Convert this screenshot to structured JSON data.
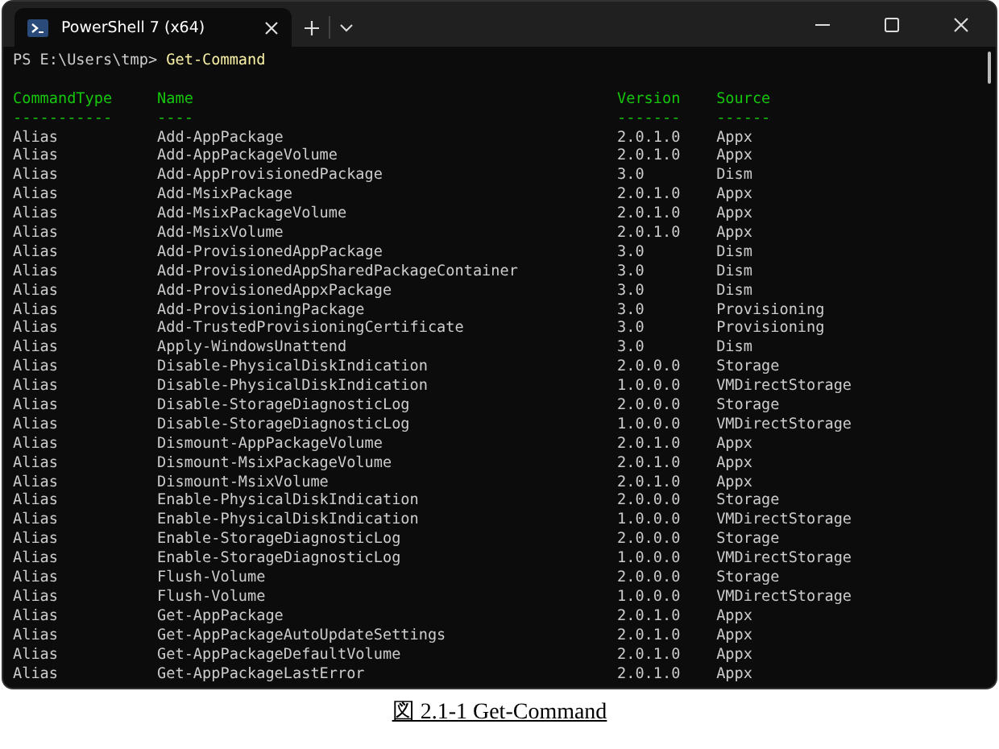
{
  "window": {
    "tab": {
      "title": "PowerShell 7 (x64)",
      "selected": true
    }
  },
  "terminal": {
    "prompt": "PS E:\\Users\\tmp>",
    "command": "Get-Command",
    "columns": [
      {
        "label": "CommandType",
        "underline": "-----------"
      },
      {
        "label": "Name",
        "underline": "----"
      },
      {
        "label": "Version",
        "underline": "-------"
      },
      {
        "label": "Source",
        "underline": "------"
      }
    ],
    "rows": [
      [
        "Alias",
        "Add-AppPackage",
        "2.0.1.0",
        "Appx"
      ],
      [
        "Alias",
        "Add-AppPackageVolume",
        "2.0.1.0",
        "Appx"
      ],
      [
        "Alias",
        "Add-AppProvisionedPackage",
        "3.0",
        "Dism"
      ],
      [
        "Alias",
        "Add-MsixPackage",
        "2.0.1.0",
        "Appx"
      ],
      [
        "Alias",
        "Add-MsixPackageVolume",
        "2.0.1.0",
        "Appx"
      ],
      [
        "Alias",
        "Add-MsixVolume",
        "2.0.1.0",
        "Appx"
      ],
      [
        "Alias",
        "Add-ProvisionedAppPackage",
        "3.0",
        "Dism"
      ],
      [
        "Alias",
        "Add-ProvisionedAppSharedPackageContainer",
        "3.0",
        "Dism"
      ],
      [
        "Alias",
        "Add-ProvisionedAppxPackage",
        "3.0",
        "Dism"
      ],
      [
        "Alias",
        "Add-ProvisioningPackage",
        "3.0",
        "Provisioning"
      ],
      [
        "Alias",
        "Add-TrustedProvisioningCertificate",
        "3.0",
        "Provisioning"
      ],
      [
        "Alias",
        "Apply-WindowsUnattend",
        "3.0",
        "Dism"
      ],
      [
        "Alias",
        "Disable-PhysicalDiskIndication",
        "2.0.0.0",
        "Storage"
      ],
      [
        "Alias",
        "Disable-PhysicalDiskIndication",
        "1.0.0.0",
        "VMDirectStorage"
      ],
      [
        "Alias",
        "Disable-StorageDiagnosticLog",
        "2.0.0.0",
        "Storage"
      ],
      [
        "Alias",
        "Disable-StorageDiagnosticLog",
        "1.0.0.0",
        "VMDirectStorage"
      ],
      [
        "Alias",
        "Dismount-AppPackageVolume",
        "2.0.1.0",
        "Appx"
      ],
      [
        "Alias",
        "Dismount-MsixPackageVolume",
        "2.0.1.0",
        "Appx"
      ],
      [
        "Alias",
        "Dismount-MsixVolume",
        "2.0.1.0",
        "Appx"
      ],
      [
        "Alias",
        "Enable-PhysicalDiskIndication",
        "2.0.0.0",
        "Storage"
      ],
      [
        "Alias",
        "Enable-PhysicalDiskIndication",
        "1.0.0.0",
        "VMDirectStorage"
      ],
      [
        "Alias",
        "Enable-StorageDiagnosticLog",
        "2.0.0.0",
        "Storage"
      ],
      [
        "Alias",
        "Enable-StorageDiagnosticLog",
        "1.0.0.0",
        "VMDirectStorage"
      ],
      [
        "Alias",
        "Flush-Volume",
        "2.0.0.0",
        "Storage"
      ],
      [
        "Alias",
        "Flush-Volume",
        "1.0.0.0",
        "VMDirectStorage"
      ],
      [
        "Alias",
        "Get-AppPackage",
        "2.0.1.0",
        "Appx"
      ],
      [
        "Alias",
        "Get-AppPackageAutoUpdateSettings",
        "2.0.1.0",
        "Appx"
      ],
      [
        "Alias",
        "Get-AppPackageDefaultVolume",
        "2.0.1.0",
        "Appx"
      ],
      [
        "Alias",
        "Get-AppPackageLastError",
        "2.0.1.0",
        "Appx"
      ]
    ]
  },
  "caption": "図 2.1-1 Get-Command"
}
